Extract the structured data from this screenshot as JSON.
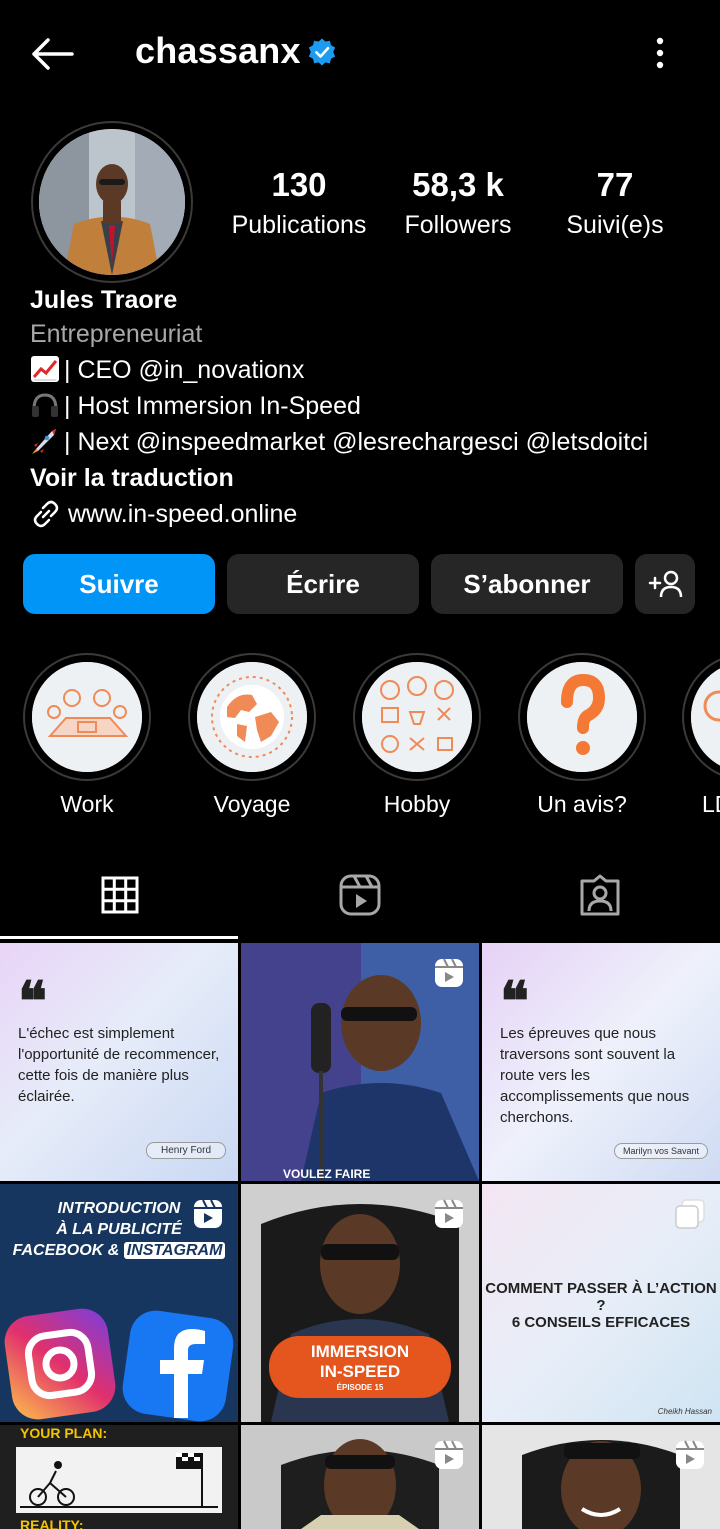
{
  "header": {
    "username": "chassanx",
    "verified_icon": "verified-badge-icon",
    "back_icon": "arrow-left-icon",
    "more_icon": "more-vertical-icon"
  },
  "stats": [
    {
      "value": "130",
      "label": "Publications"
    },
    {
      "value": "58,3 k",
      "label": "Followers"
    },
    {
      "value": "77",
      "label": "Suivi(e)s"
    }
  ],
  "bio": {
    "name": "Jules Traore",
    "category": "Entrepreneuriat",
    "lines": [
      {
        "icon": "chart-increasing-emoji",
        "text": "| CEO @in_novationx"
      },
      {
        "icon": "headphone-emoji",
        "text": "| Host Immersion In-Speed"
      },
      {
        "icon": "rocket-emoji",
        "text": "| Next @inspeedmarket @lesrechargesci @letsdoitci"
      }
    ],
    "translate": "Voir la traduction",
    "link": "www.in-speed.online"
  },
  "actions": {
    "follow": "Suivre",
    "message": "Écrire",
    "subscribe": "S’abonner",
    "suggest_icon": "add-person-icon"
  },
  "highlights": [
    {
      "label": "Work"
    },
    {
      "label": "Voyage"
    },
    {
      "label": "Hobby"
    },
    {
      "label": "Un avis?"
    },
    {
      "label": "LD"
    }
  ],
  "tabs": [
    {
      "icon": "grid-icon",
      "active": true
    },
    {
      "icon": "reels-icon",
      "active": false
    },
    {
      "icon": "tagged-icon",
      "active": false
    }
  ],
  "posts": {
    "p1": {
      "quote": "L'échec est simplement l'opportunité de recommencer, cette fois de manière plus éclairée.",
      "author": "Henry Ford"
    },
    "p2": {
      "caption": "VOULEZ FAIRE"
    },
    "p3": {
      "quote": "Les épreuves que nous traversons sont souvent la route vers les accomplissements que nous cherchons.",
      "author": "Marilyn vos Savant"
    },
    "p4": {
      "line1": "INTRODUCTION",
      "line2": "À LA PUBLICITÉ",
      "line3": "FACEBOOK &",
      "line4": "INSTAGRAM"
    },
    "p5": {
      "title1": "IMMERSION",
      "title2": "IN-SPEED",
      "episode": "ÉPISODE 15"
    },
    "p6": {
      "title1": "COMMENT PASSER À L’ACTION ?",
      "title2": "6 CONSEILS EFFICACES",
      "signature": "Cheikh Hassan"
    },
    "p7": {
      "title": "YOUR PLAN:",
      "subtitle": "REALITY:"
    }
  },
  "colors": {
    "follow_blue": "#0095f6",
    "button_grey": "#262626",
    "verified_blue": "#1d9bf0",
    "secondary_text": "#a8a8a8"
  }
}
